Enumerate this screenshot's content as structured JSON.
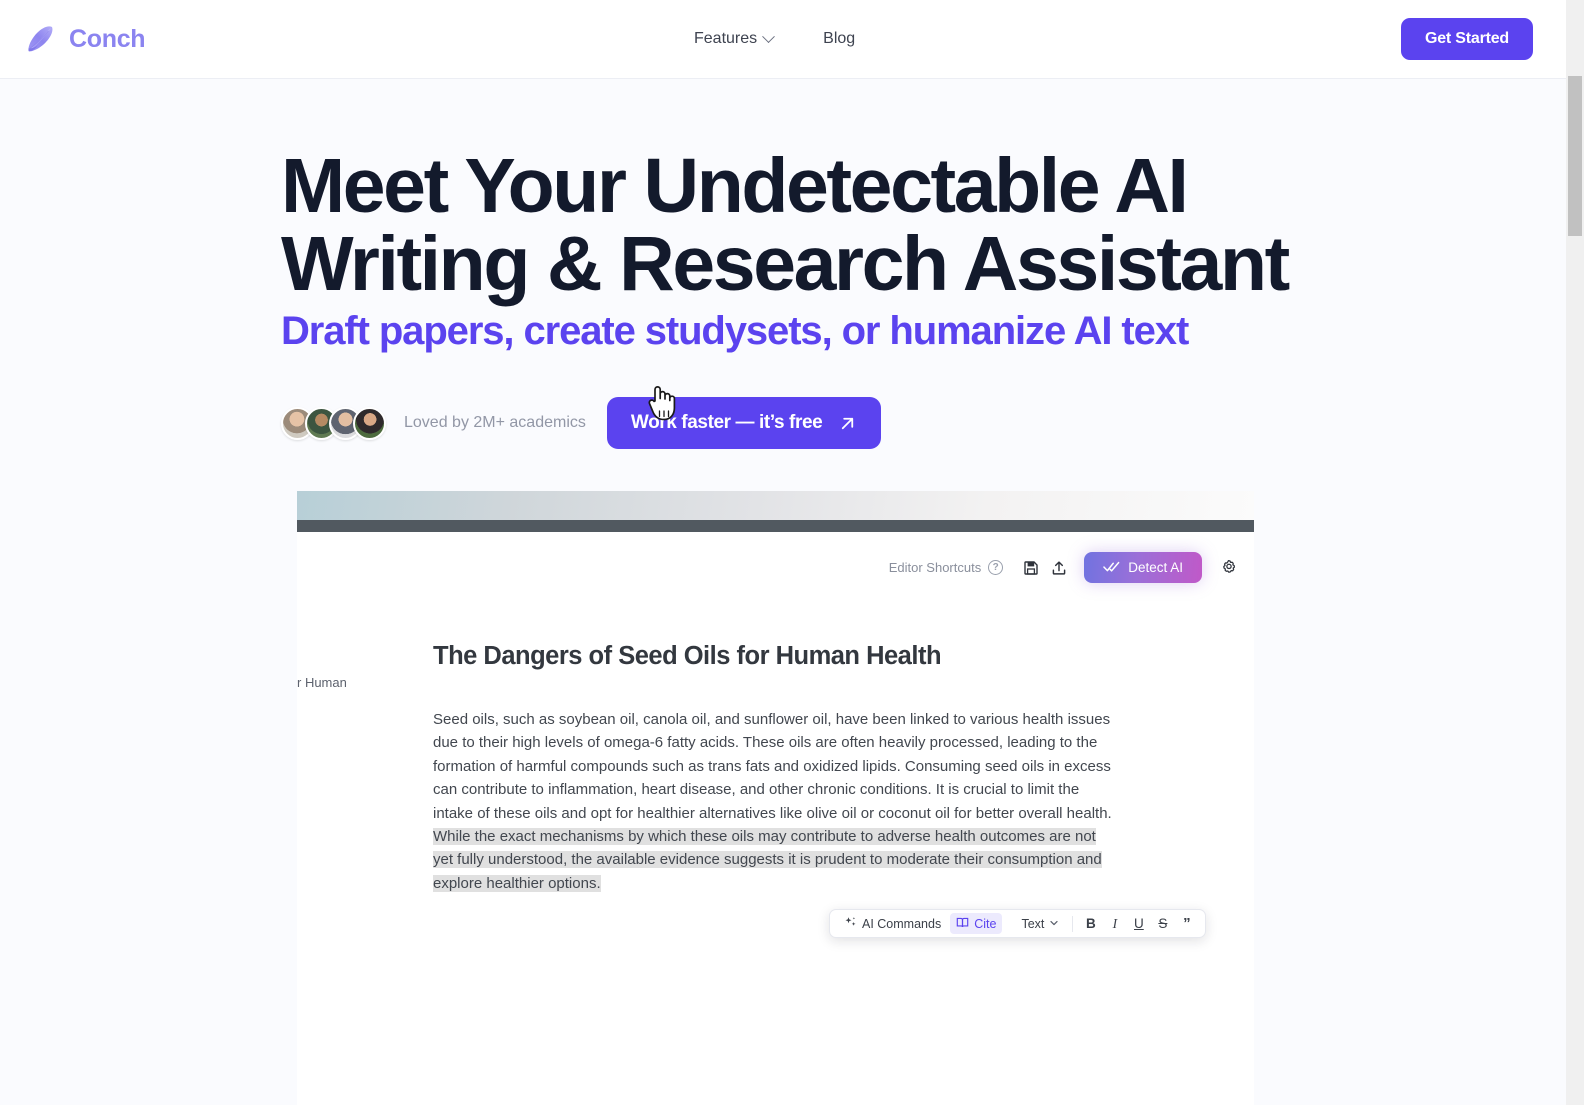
{
  "header": {
    "brand_name": "Conch",
    "brand_icon": "conch-shell-icon",
    "nav": [
      {
        "label": "Features",
        "has_chevron": true
      },
      {
        "label": "Blog",
        "has_chevron": false
      }
    ],
    "cta_label": "Get Started"
  },
  "hero": {
    "title_line1": "Meet Your Undetectable AI",
    "title_line2": "Writing & Research Assistant",
    "subtitle": "Draft papers, create studysets, or humanize AI text",
    "proof_text": "Loved by 2M+ academics",
    "cta_label": "Work faster — it’s free",
    "cta_icon": "arrow-up-right-icon",
    "avatar_count": 4
  },
  "editor": {
    "toolbar": {
      "shortcuts_label": "Editor Shortcuts",
      "help_icon": "question-circle-icon",
      "save_icon": "floppy-disk-icon",
      "upload_icon": "upload-icon",
      "detect_ai_label": "Detect AI",
      "detect_ai_icon": "double-check-icon",
      "settings_icon": "gear-icon"
    },
    "side_snippet": "r Human",
    "document": {
      "title": "The Dangers of Seed Oils for Human Health",
      "paragraph_plain": "Seed oils, such as soybean oil, canola oil, and sunflower oil, have been linked to various health issues due to their high levels of omega-6 fatty acids. These oils are often heavily processed, leading to the formation of harmful compounds such as trans fats and oxidized lipids. Consuming seed oils in excess can contribute to inflammation, heart disease, and other chronic conditions. It is crucial to limit the intake of these oils and opt for healthier alternatives like olive oil or coconut oil for better overall health. ",
      "paragraph_selected": "While the exact mechanisms by which these oils may contribute to adverse health outcomes are not yet fully understood, the available evidence suggests it is prudent to moderate their consumption and explore healthier options."
    },
    "format_toolbar": {
      "ai_commands_label": "AI Commands",
      "ai_commands_icon": "sparkles-icon",
      "cite_label": "Cite",
      "cite_icon": "open-book-icon",
      "text_label": "Text",
      "text_chevron_icon": "chevron-down-icon",
      "bold_label": "B",
      "italic_label": "I",
      "underline_label": "U",
      "strikethrough_label": "S",
      "quote_label": "”"
    }
  },
  "colors": {
    "accent_purple": "#5b43ef",
    "brand_light_purple": "#8b84f0",
    "heading_navy": "#131a2c",
    "page_bg": "#fafbfe",
    "selection_gray": "#e0e0e0"
  }
}
